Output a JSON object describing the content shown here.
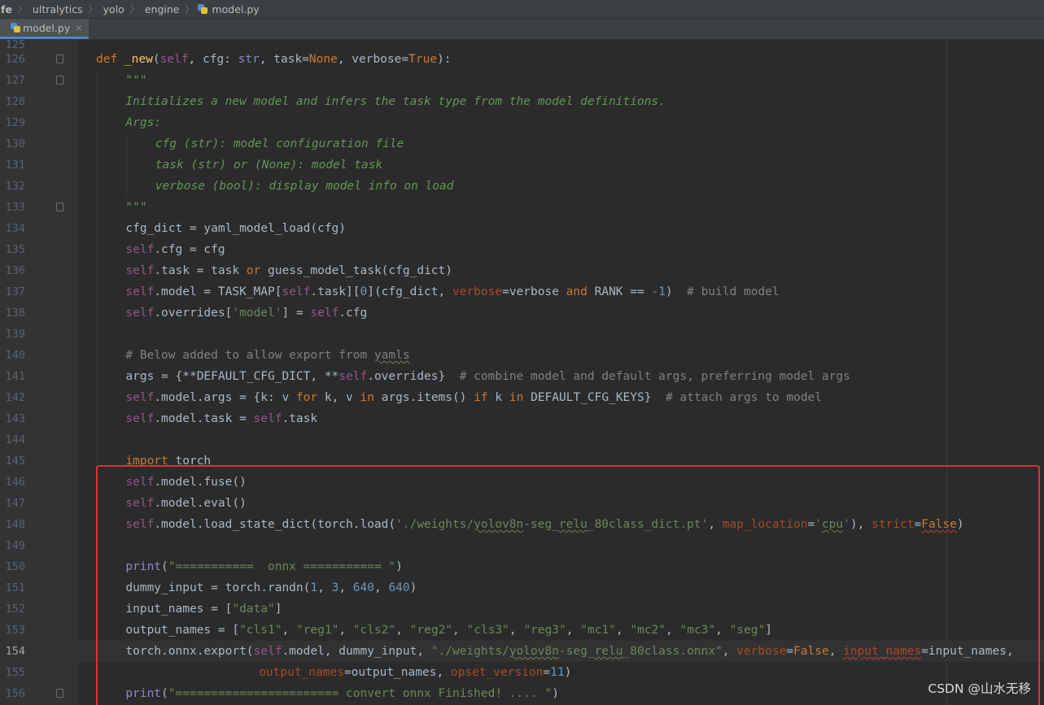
{
  "breadcrumb": [
    "fe",
    "ultralytics",
    "yolo",
    "engine",
    "model.py"
  ],
  "tab": {
    "label": "model.py",
    "close": "×",
    "icon": "python-file-icon"
  },
  "ghost_line_number": "125",
  "current_line": "154",
  "watermark": "CSDN @山水无移",
  "highlight_color": "#e03030",
  "lines": [
    {
      "num": "126",
      "fold": true,
      "indent": 0,
      "tokens": [
        {
          "t": "def ",
          "c": "k"
        },
        {
          "t": "_new",
          "c": "f"
        },
        {
          "t": "(",
          "c": ""
        },
        {
          "t": "self",
          "c": "sf"
        },
        {
          "t": ", cfg: ",
          "c": ""
        },
        {
          "t": "str",
          "c": "s"
        },
        {
          "t": ", task=",
          "c": ""
        },
        {
          "t": "None",
          "c": "k"
        },
        {
          "t": ", verbose=",
          "c": ""
        },
        {
          "t": "True",
          "c": "k"
        },
        {
          "t": "):",
          "c": ""
        }
      ]
    },
    {
      "num": "127",
      "fold": true,
      "indent": 1,
      "tokens": [
        {
          "t": "\"\"\"",
          "c": "doc"
        }
      ]
    },
    {
      "num": "128",
      "indent": 1,
      "tokens": [
        {
          "t": "Initializes a new model and infers the task type from the model definitions.",
          "c": "doc"
        }
      ]
    },
    {
      "num": "129",
      "indent": 1,
      "tokens": [
        {
          "t": "Args:",
          "c": "doc"
        }
      ]
    },
    {
      "num": "130",
      "indent": 2,
      "tokens": [
        {
          "t": "cfg (str): model configuration file",
          "c": "doc"
        }
      ]
    },
    {
      "num": "131",
      "indent": 2,
      "tokens": [
        {
          "t": "task (str) or (None): model task",
          "c": "doc"
        }
      ]
    },
    {
      "num": "132",
      "indent": 2,
      "tokens": [
        {
          "t": "verbose (bool): display model info on load",
          "c": "doc"
        }
      ]
    },
    {
      "num": "133",
      "fold": true,
      "indent": 1,
      "tokens": [
        {
          "t": "\"\"\"",
          "c": "doc"
        }
      ]
    },
    {
      "num": "134",
      "indent": 1,
      "tokens": [
        {
          "t": "cfg_dict = yaml_model_load(cfg)",
          "c": ""
        }
      ]
    },
    {
      "num": "135",
      "indent": 1,
      "tokens": [
        {
          "t": "self",
          "c": "sf"
        },
        {
          "t": ".cfg = cfg",
          "c": ""
        }
      ]
    },
    {
      "num": "136",
      "indent": 1,
      "tokens": [
        {
          "t": "self",
          "c": "sf"
        },
        {
          "t": ".task = task ",
          "c": ""
        },
        {
          "t": "or",
          "c": "k"
        },
        {
          "t": " guess_model_task(cfg_dict)",
          "c": ""
        }
      ]
    },
    {
      "num": "137",
      "indent": 1,
      "tokens": [
        {
          "t": "self",
          "c": "sf"
        },
        {
          "t": ".model = TASK_MAP[",
          "c": ""
        },
        {
          "t": "self",
          "c": "sf"
        },
        {
          "t": ".task][",
          "c": ""
        },
        {
          "t": "0",
          "c": "n"
        },
        {
          "t": "](cfg_dict, ",
          "c": ""
        },
        {
          "t": "verbose",
          "c": "p"
        },
        {
          "t": "=verbose ",
          "c": ""
        },
        {
          "t": "and",
          "c": "k"
        },
        {
          "t": " RANK == ",
          "c": ""
        },
        {
          "t": "-1",
          "c": "n"
        },
        {
          "t": ")  ",
          "c": ""
        },
        {
          "t": "# build model",
          "c": "c"
        }
      ]
    },
    {
      "num": "138",
      "indent": 1,
      "tokens": [
        {
          "t": "self",
          "c": "sf"
        },
        {
          "t": ".overrides[",
          "c": ""
        },
        {
          "t": "'model'",
          "c": "st"
        },
        {
          "t": "] = ",
          "c": ""
        },
        {
          "t": "self",
          "c": "sf"
        },
        {
          "t": ".cfg",
          "c": ""
        }
      ]
    },
    {
      "num": "139",
      "indent": 1,
      "tokens": []
    },
    {
      "num": "140",
      "indent": 1,
      "tokens": [
        {
          "t": "# Below added to allow export from ",
          "c": "c"
        },
        {
          "t": "yamls",
          "c": "c u"
        }
      ]
    },
    {
      "num": "141",
      "indent": 1,
      "tokens": [
        {
          "t": "args = {**DEFAULT_CFG_DICT, **",
          "c": ""
        },
        {
          "t": "self",
          "c": "sf"
        },
        {
          "t": ".overrides}  ",
          "c": ""
        },
        {
          "t": "# combine model and default args, preferring model args",
          "c": "c"
        }
      ]
    },
    {
      "num": "142",
      "indent": 1,
      "tokens": [
        {
          "t": "self",
          "c": "sf"
        },
        {
          "t": ".model.args = {k: v ",
          "c": ""
        },
        {
          "t": "for",
          "c": "k"
        },
        {
          "t": " k, v ",
          "c": ""
        },
        {
          "t": "in",
          "c": "k"
        },
        {
          "t": " args.items() ",
          "c": ""
        },
        {
          "t": "if",
          "c": "k"
        },
        {
          "t": " k ",
          "c": ""
        },
        {
          "t": "in",
          "c": "k"
        },
        {
          "t": " DEFAULT_CFG_KEYS}  ",
          "c": ""
        },
        {
          "t": "# attach args to model",
          "c": "c"
        }
      ]
    },
    {
      "num": "143",
      "indent": 1,
      "tokens": [
        {
          "t": "self",
          "c": "sf"
        },
        {
          "t": ".model.task = ",
          "c": ""
        },
        {
          "t": "self",
          "c": "sf"
        },
        {
          "t": ".task",
          "c": ""
        }
      ]
    },
    {
      "num": "144",
      "indent": 1,
      "tokens": []
    },
    {
      "num": "145",
      "indent": 1,
      "tokens": [
        {
          "t": "import",
          "c": "k"
        },
        {
          "t": " torch",
          "c": ""
        }
      ]
    },
    {
      "num": "146",
      "indent": 1,
      "tokens": [
        {
          "t": "self",
          "c": "sf"
        },
        {
          "t": ".model.fuse()",
          "c": ""
        }
      ]
    },
    {
      "num": "147",
      "indent": 1,
      "tokens": [
        {
          "t": "self",
          "c": "sf"
        },
        {
          "t": ".model.eval()",
          "c": ""
        }
      ]
    },
    {
      "num": "148",
      "indent": 1,
      "tokens": [
        {
          "t": "self",
          "c": "sf"
        },
        {
          "t": ".model.load_state_dict(torch.load(",
          "c": ""
        },
        {
          "t": "'./weights/",
          "c": "st"
        },
        {
          "t": "yolov8n",
          "c": "st u"
        },
        {
          "t": "-seg_",
          "c": "st"
        },
        {
          "t": "relu",
          "c": "st u"
        },
        {
          "t": "_80class_dict.pt'",
          "c": "st"
        },
        {
          "t": ", ",
          "c": ""
        },
        {
          "t": "map_location",
          "c": "p"
        },
        {
          "t": "=",
          "c": ""
        },
        {
          "t": "'",
          "c": "st"
        },
        {
          "t": "cpu",
          "c": "st u"
        },
        {
          "t": "'",
          "c": "st"
        },
        {
          "t": "), ",
          "c": ""
        },
        {
          "t": "strict",
          "c": "p"
        },
        {
          "t": "=",
          "c": ""
        },
        {
          "t": "False",
          "c": "k ur"
        },
        {
          "t": ")",
          "c": ""
        }
      ]
    },
    {
      "num": "149",
      "indent": 1,
      "tokens": []
    },
    {
      "num": "150",
      "indent": 1,
      "tokens": [
        {
          "t": "print",
          "c": "s"
        },
        {
          "t": "(",
          "c": ""
        },
        {
          "t": "\"===========  onnx =========== \"",
          "c": "st"
        },
        {
          "t": ")",
          "c": ""
        }
      ]
    },
    {
      "num": "151",
      "indent": 1,
      "tokens": [
        {
          "t": "dummy_input = torch.randn(",
          "c": ""
        },
        {
          "t": "1",
          "c": "n"
        },
        {
          "t": ", ",
          "c": ""
        },
        {
          "t": "3",
          "c": "n"
        },
        {
          "t": ", ",
          "c": ""
        },
        {
          "t": "640",
          "c": "n"
        },
        {
          "t": ", ",
          "c": ""
        },
        {
          "t": "640",
          "c": "n"
        },
        {
          "t": ")",
          "c": ""
        }
      ]
    },
    {
      "num": "152",
      "indent": 1,
      "tokens": [
        {
          "t": "input_names = [",
          "c": ""
        },
        {
          "t": "\"data\"",
          "c": "st"
        },
        {
          "t": "]",
          "c": ""
        }
      ]
    },
    {
      "num": "153",
      "indent": 1,
      "tokens": [
        {
          "t": "output_names = [",
          "c": ""
        },
        {
          "t": "\"cls1\"",
          "c": "st"
        },
        {
          "t": ", ",
          "c": ""
        },
        {
          "t": "\"reg1\"",
          "c": "st"
        },
        {
          "t": ", ",
          "c": ""
        },
        {
          "t": "\"cls2\"",
          "c": "st"
        },
        {
          "t": ", ",
          "c": ""
        },
        {
          "t": "\"reg2\"",
          "c": "st"
        },
        {
          "t": ", ",
          "c": ""
        },
        {
          "t": "\"cls3\"",
          "c": "st"
        },
        {
          "t": ", ",
          "c": ""
        },
        {
          "t": "\"reg3\"",
          "c": "st"
        },
        {
          "t": ", ",
          "c": ""
        },
        {
          "t": "\"mc1\"",
          "c": "st"
        },
        {
          "t": ", ",
          "c": ""
        },
        {
          "t": "\"mc2\"",
          "c": "st"
        },
        {
          "t": ", ",
          "c": ""
        },
        {
          "t": "\"mc3\"",
          "c": "st"
        },
        {
          "t": ", ",
          "c": ""
        },
        {
          "t": "\"seg\"",
          "c": "st"
        },
        {
          "t": "]",
          "c": ""
        }
      ]
    },
    {
      "num": "154",
      "indent": 1,
      "tokens": [
        {
          "t": "torch.onnx.export(",
          "c": ""
        },
        {
          "t": "self",
          "c": "sf"
        },
        {
          "t": ".model, dummy_input, ",
          "c": ""
        },
        {
          "t": "\"./weights/",
          "c": "st"
        },
        {
          "t": "yolov8n",
          "c": "st u"
        },
        {
          "t": "-seg_",
          "c": "st"
        },
        {
          "t": "relu",
          "c": "st u"
        },
        {
          "t": "_80class.onnx\"",
          "c": "st"
        },
        {
          "t": ", ",
          "c": ""
        },
        {
          "t": "verbose",
          "c": "p"
        },
        {
          "t": "=",
          "c": ""
        },
        {
          "t": "False",
          "c": "k"
        },
        {
          "t": ", ",
          "c": ""
        },
        {
          "t": "input_names",
          "c": "p ur"
        },
        {
          "t": "=input_names,",
          "c": ""
        }
      ]
    },
    {
      "num": "155",
      "indent": 1,
      "pad": "                  ",
      "tokens": [
        {
          "t": "output_names",
          "c": "p"
        },
        {
          "t": "=output_names, ",
          "c": ""
        },
        {
          "t": "opset_version",
          "c": "p"
        },
        {
          "t": "=",
          "c": ""
        },
        {
          "t": "11",
          "c": "n"
        },
        {
          "t": ")",
          "c": ""
        }
      ]
    },
    {
      "num": "156",
      "fold": true,
      "indent": 1,
      "tokens": [
        {
          "t": "print",
          "c": "s"
        },
        {
          "t": "(",
          "c": ""
        },
        {
          "t": "\"======================= convert onnx Finished! .... \"",
          "c": "st"
        },
        {
          "t": ")",
          "c": ""
        }
      ]
    }
  ]
}
